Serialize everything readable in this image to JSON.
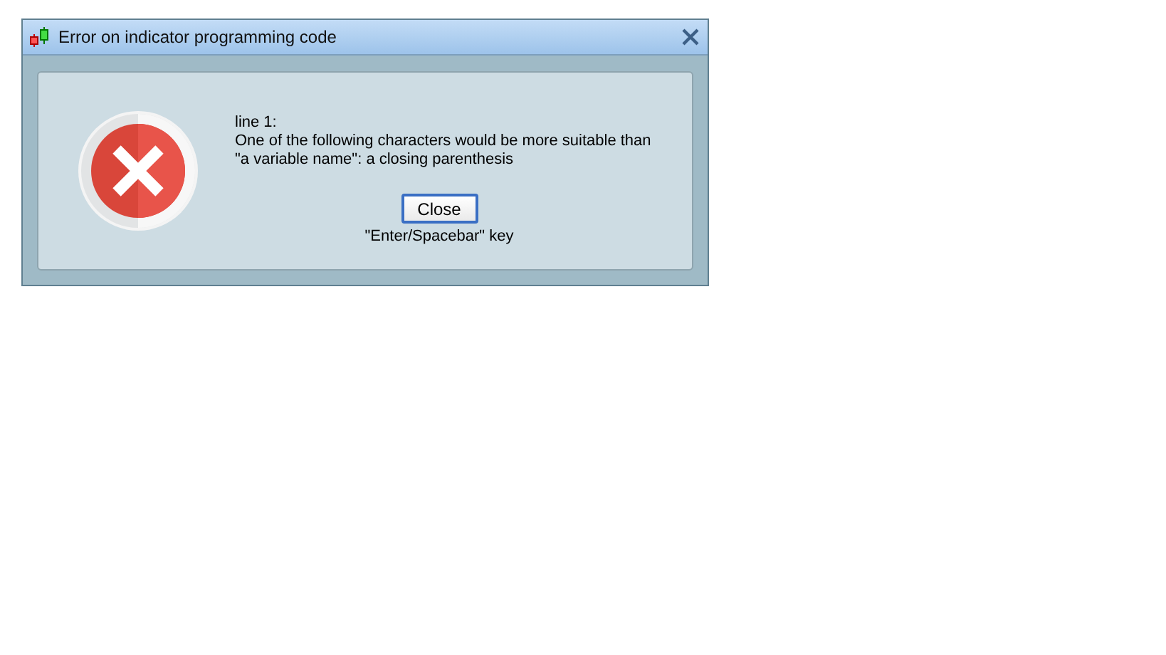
{
  "window": {
    "title": "Error on indicator programming code"
  },
  "message": {
    "lines": [
      "line 1:",
      "One of the following characters would be more suitable than",
      "\"a variable name\": a closing parenthesis"
    ]
  },
  "button": {
    "label": "Close"
  },
  "hint": "\"Enter/Spacebar\" key"
}
